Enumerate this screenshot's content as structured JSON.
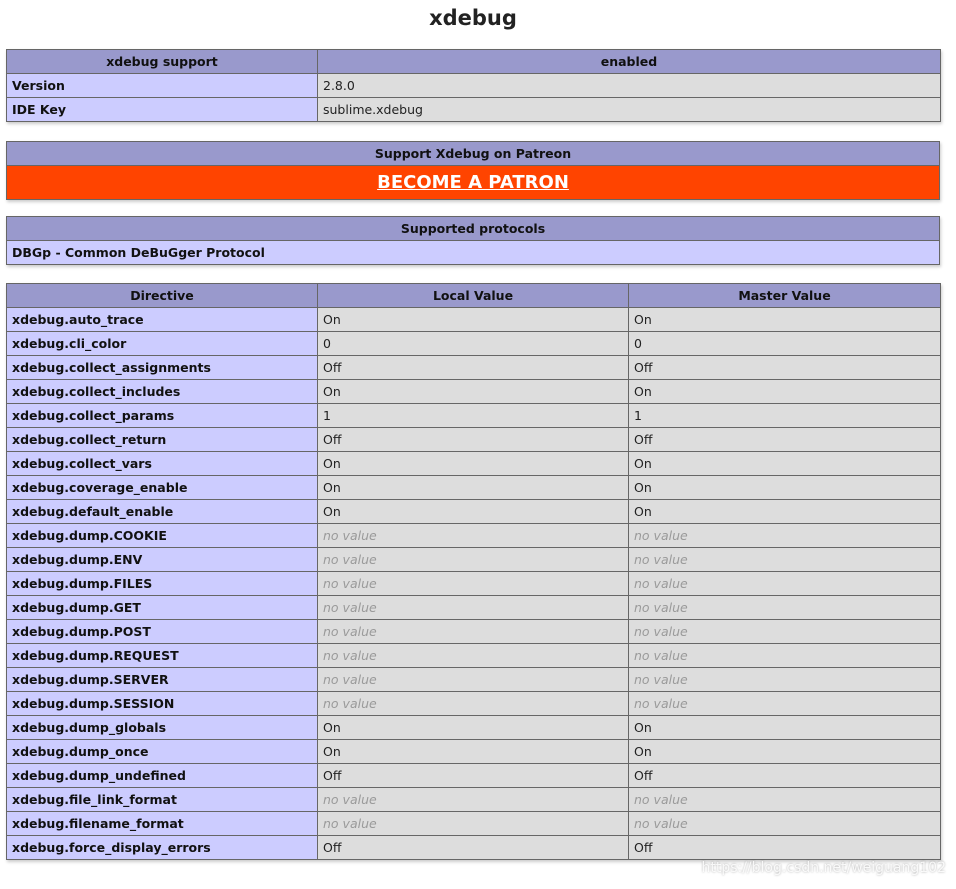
{
  "title": "xdebug",
  "support_table": {
    "header": [
      "xdebug support",
      "enabled"
    ],
    "rows": [
      {
        "directive": "Version",
        "value": "2.8.0"
      },
      {
        "directive": "IDE Key",
        "value": "sublime.xdebug"
      }
    ]
  },
  "patron": {
    "header": "Support Xdebug on Patreon",
    "link_label": "BECOME A PATRON",
    "accent_color": "#ff4400"
  },
  "protocols": {
    "header": "Supported protocols",
    "items": [
      "DBGp - Common DeBuGger Protocol"
    ]
  },
  "directives": {
    "headers": [
      "Directive",
      "Local Value",
      "Master Value"
    ],
    "rows": [
      {
        "name": "xdebug.auto_trace",
        "local": "On",
        "master": "On"
      },
      {
        "name": "xdebug.cli_color",
        "local": "0",
        "master": "0"
      },
      {
        "name": "xdebug.collect_assignments",
        "local": "Off",
        "master": "Off"
      },
      {
        "name": "xdebug.collect_includes",
        "local": "On",
        "master": "On"
      },
      {
        "name": "xdebug.collect_params",
        "local": "1",
        "master": "1"
      },
      {
        "name": "xdebug.collect_return",
        "local": "Off",
        "master": "Off"
      },
      {
        "name": "xdebug.collect_vars",
        "local": "On",
        "master": "On"
      },
      {
        "name": "xdebug.coverage_enable",
        "local": "On",
        "master": "On"
      },
      {
        "name": "xdebug.default_enable",
        "local": "On",
        "master": "On"
      },
      {
        "name": "xdebug.dump.COOKIE",
        "local": "no value",
        "master": "no value"
      },
      {
        "name": "xdebug.dump.ENV",
        "local": "no value",
        "master": "no value"
      },
      {
        "name": "xdebug.dump.FILES",
        "local": "no value",
        "master": "no value"
      },
      {
        "name": "xdebug.dump.GET",
        "local": "no value",
        "master": "no value"
      },
      {
        "name": "xdebug.dump.POST",
        "local": "no value",
        "master": "no value"
      },
      {
        "name": "xdebug.dump.REQUEST",
        "local": "no value",
        "master": "no value"
      },
      {
        "name": "xdebug.dump.SERVER",
        "local": "no value",
        "master": "no value"
      },
      {
        "name": "xdebug.dump.SESSION",
        "local": "no value",
        "master": "no value"
      },
      {
        "name": "xdebug.dump_globals",
        "local": "On",
        "master": "On"
      },
      {
        "name": "xdebug.dump_once",
        "local": "On",
        "master": "On"
      },
      {
        "name": "xdebug.dump_undefined",
        "local": "Off",
        "master": "Off"
      },
      {
        "name": "xdebug.file_link_format",
        "local": "no value",
        "master": "no value"
      },
      {
        "name": "xdebug.filename_format",
        "local": "no value",
        "master": "no value"
      },
      {
        "name": "xdebug.force_display_errors",
        "local": "Off",
        "master": "Off"
      }
    ]
  },
  "watermark": "https://blog.csdn.net/weiguang102",
  "colors": {
    "header_bg": "#9999cc",
    "directive_bg": "#ccccff",
    "value_bg": "#dddddd",
    "no_value_text": "#9a9a9a"
  }
}
